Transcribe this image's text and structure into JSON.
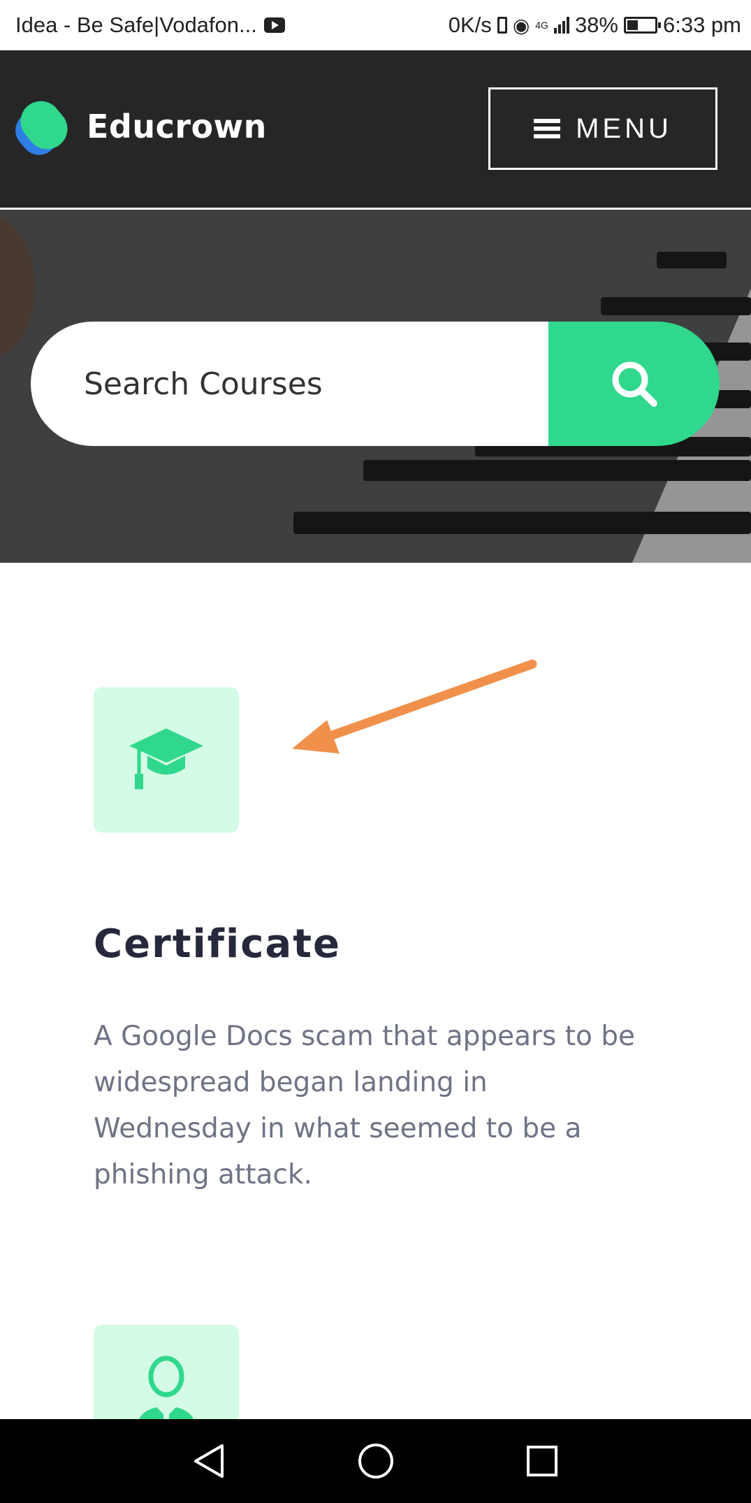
{
  "status_bar": {
    "carrier": "Idea - Be Safe|Vodafon...",
    "net_speed": "0K/s",
    "network_type": "4G",
    "battery": "38%",
    "time": "6:33 pm"
  },
  "header": {
    "brand": "Educrown",
    "menu_label": "MENU"
  },
  "search": {
    "placeholder": "Search Courses"
  },
  "features": [
    {
      "icon": "graduation-cap-icon",
      "title": "Certificate",
      "description": "A Google Docs scam that appears to be widespread began landing in Wednesday in what seemed to be a phishing attack."
    },
    {
      "icon": "user-icon"
    }
  ],
  "colors": {
    "accent": "#2fd88c",
    "icon_bg": "#d4fbe5",
    "header_bg": "#262626",
    "annotation_arrow": "#f0904a"
  }
}
